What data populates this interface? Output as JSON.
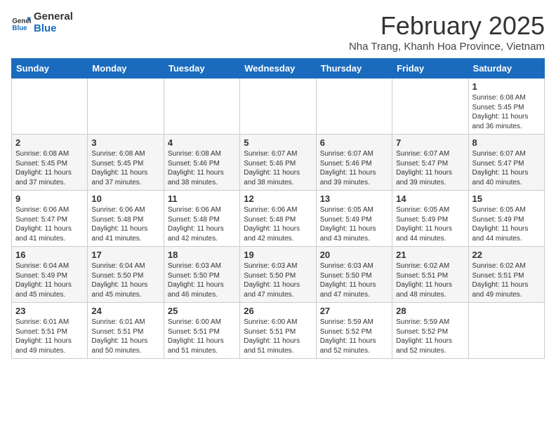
{
  "logo": {
    "line1": "General",
    "line2": "Blue"
  },
  "title": "February 2025",
  "location": "Nha Trang, Khanh Hoa Province, Vietnam",
  "days_of_week": [
    "Sunday",
    "Monday",
    "Tuesday",
    "Wednesday",
    "Thursday",
    "Friday",
    "Saturday"
  ],
  "weeks": [
    [
      {
        "day": "",
        "content": ""
      },
      {
        "day": "",
        "content": ""
      },
      {
        "day": "",
        "content": ""
      },
      {
        "day": "",
        "content": ""
      },
      {
        "day": "",
        "content": ""
      },
      {
        "day": "",
        "content": ""
      },
      {
        "day": "1",
        "content": "Sunrise: 6:08 AM\nSunset: 5:45 PM\nDaylight: 11 hours\nand 36 minutes."
      }
    ],
    [
      {
        "day": "2",
        "content": "Sunrise: 6:08 AM\nSunset: 5:45 PM\nDaylight: 11 hours\nand 37 minutes."
      },
      {
        "day": "3",
        "content": "Sunrise: 6:08 AM\nSunset: 5:45 PM\nDaylight: 11 hours\nand 37 minutes."
      },
      {
        "day": "4",
        "content": "Sunrise: 6:08 AM\nSunset: 5:46 PM\nDaylight: 11 hours\nand 38 minutes."
      },
      {
        "day": "5",
        "content": "Sunrise: 6:07 AM\nSunset: 5:46 PM\nDaylight: 11 hours\nand 38 minutes."
      },
      {
        "day": "6",
        "content": "Sunrise: 6:07 AM\nSunset: 5:46 PM\nDaylight: 11 hours\nand 39 minutes."
      },
      {
        "day": "7",
        "content": "Sunrise: 6:07 AM\nSunset: 5:47 PM\nDaylight: 11 hours\nand 39 minutes."
      },
      {
        "day": "8",
        "content": "Sunrise: 6:07 AM\nSunset: 5:47 PM\nDaylight: 11 hours\nand 40 minutes."
      }
    ],
    [
      {
        "day": "9",
        "content": "Sunrise: 6:06 AM\nSunset: 5:47 PM\nDaylight: 11 hours\nand 41 minutes."
      },
      {
        "day": "10",
        "content": "Sunrise: 6:06 AM\nSunset: 5:48 PM\nDaylight: 11 hours\nand 41 minutes."
      },
      {
        "day": "11",
        "content": "Sunrise: 6:06 AM\nSunset: 5:48 PM\nDaylight: 11 hours\nand 42 minutes."
      },
      {
        "day": "12",
        "content": "Sunrise: 6:06 AM\nSunset: 5:48 PM\nDaylight: 11 hours\nand 42 minutes."
      },
      {
        "day": "13",
        "content": "Sunrise: 6:05 AM\nSunset: 5:49 PM\nDaylight: 11 hours\nand 43 minutes."
      },
      {
        "day": "14",
        "content": "Sunrise: 6:05 AM\nSunset: 5:49 PM\nDaylight: 11 hours\nand 44 minutes."
      },
      {
        "day": "15",
        "content": "Sunrise: 6:05 AM\nSunset: 5:49 PM\nDaylight: 11 hours\nand 44 minutes."
      }
    ],
    [
      {
        "day": "16",
        "content": "Sunrise: 6:04 AM\nSunset: 5:49 PM\nDaylight: 11 hours\nand 45 minutes."
      },
      {
        "day": "17",
        "content": "Sunrise: 6:04 AM\nSunset: 5:50 PM\nDaylight: 11 hours\nand 45 minutes."
      },
      {
        "day": "18",
        "content": "Sunrise: 6:03 AM\nSunset: 5:50 PM\nDaylight: 11 hours\nand 46 minutes."
      },
      {
        "day": "19",
        "content": "Sunrise: 6:03 AM\nSunset: 5:50 PM\nDaylight: 11 hours\nand 47 minutes."
      },
      {
        "day": "20",
        "content": "Sunrise: 6:03 AM\nSunset: 5:50 PM\nDaylight: 11 hours\nand 47 minutes."
      },
      {
        "day": "21",
        "content": "Sunrise: 6:02 AM\nSunset: 5:51 PM\nDaylight: 11 hours\nand 48 minutes."
      },
      {
        "day": "22",
        "content": "Sunrise: 6:02 AM\nSunset: 5:51 PM\nDaylight: 11 hours\nand 49 minutes."
      }
    ],
    [
      {
        "day": "23",
        "content": "Sunrise: 6:01 AM\nSunset: 5:51 PM\nDaylight: 11 hours\nand 49 minutes."
      },
      {
        "day": "24",
        "content": "Sunrise: 6:01 AM\nSunset: 5:51 PM\nDaylight: 11 hours\nand 50 minutes."
      },
      {
        "day": "25",
        "content": "Sunrise: 6:00 AM\nSunset: 5:51 PM\nDaylight: 11 hours\nand 51 minutes."
      },
      {
        "day": "26",
        "content": "Sunrise: 6:00 AM\nSunset: 5:51 PM\nDaylight: 11 hours\nand 51 minutes."
      },
      {
        "day": "27",
        "content": "Sunrise: 5:59 AM\nSunset: 5:52 PM\nDaylight: 11 hours\nand 52 minutes."
      },
      {
        "day": "28",
        "content": "Sunrise: 5:59 AM\nSunset: 5:52 PM\nDaylight: 11 hours\nand 52 minutes."
      },
      {
        "day": "",
        "content": ""
      }
    ]
  ]
}
